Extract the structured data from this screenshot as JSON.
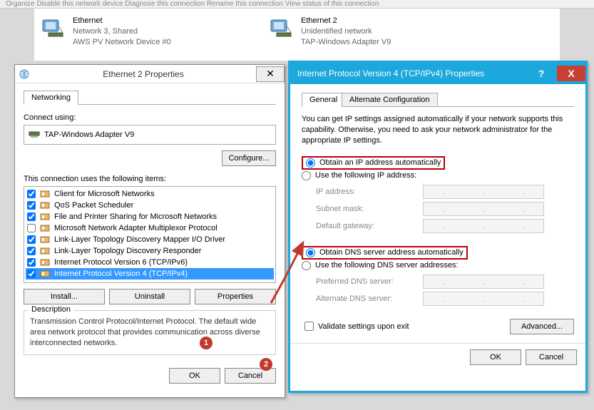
{
  "toolbar_fragments": "Organize    Disable this network device    Diagnose this connection    Rename this connection    View status of this connection",
  "connections": [
    {
      "name": "Ethernet",
      "status": "Network  3, Shared",
      "device": "AWS PV Network Device #0"
    },
    {
      "name": "Ethernet 2",
      "status": "Unidentified network",
      "device": "TAP-Windows Adapter V9"
    }
  ],
  "eth_dialog": {
    "title": "Ethernet 2 Properties",
    "tab": "Networking",
    "connect_using_label": "Connect using:",
    "adapter": "TAP-Windows Adapter V9",
    "configure_btn": "Configure...",
    "items_label": "This connection uses the following items:",
    "items": [
      {
        "checked": true,
        "label": "Client for Microsoft Networks"
      },
      {
        "checked": true,
        "label": "QoS Packet Scheduler"
      },
      {
        "checked": true,
        "label": "File and Printer Sharing for Microsoft Networks"
      },
      {
        "checked": false,
        "label": "Microsoft Network Adapter Multiplexor Protocol"
      },
      {
        "checked": true,
        "label": "Link-Layer Topology Discovery Mapper I/O Driver"
      },
      {
        "checked": true,
        "label": "Link-Layer Topology Discovery Responder"
      },
      {
        "checked": true,
        "label": "Internet Protocol Version 6 (TCP/IPv6)"
      },
      {
        "checked": true,
        "label": "Internet Protocol Version 4 (TCP/IPv4)",
        "selected": true
      }
    ],
    "install_btn": "Install...",
    "uninstall_btn": "Uninstall",
    "properties_btn": "Properties",
    "desc_legend": "Description",
    "desc_text": "Transmission Control Protocol/Internet Protocol. The default wide area network protocol that provides communication across diverse interconnected networks.",
    "ok_btn": "OK",
    "cancel_btn": "Cancel"
  },
  "ipv4_dialog": {
    "title": "Internet Protocol Version 4 (TCP/IPv4) Properties",
    "help_glyph": "?",
    "close_glyph": "X",
    "tab_general": "General",
    "tab_alt": "Alternate Configuration",
    "info": "You can get IP settings assigned automatically if your network supports this capability. Otherwise, you need to ask your network administrator for the appropriate IP settings.",
    "obtain_ip": "Obtain an IP address automatically",
    "use_ip": "Use the following IP address:",
    "ip_address": "IP address:",
    "subnet": "Subnet mask:",
    "gateway": "Default gateway:",
    "obtain_dns": "Obtain DNS server address automatically",
    "use_dns": "Use the following DNS server addresses:",
    "pref_dns": "Preferred DNS server:",
    "alt_dns": "Alternate DNS server:",
    "validate": "Validate settings upon exit",
    "advanced_btn": "Advanced...",
    "ok_btn": "OK",
    "cancel_btn": "Cancel"
  },
  "callouts": {
    "c1": "1",
    "c2": "2"
  }
}
